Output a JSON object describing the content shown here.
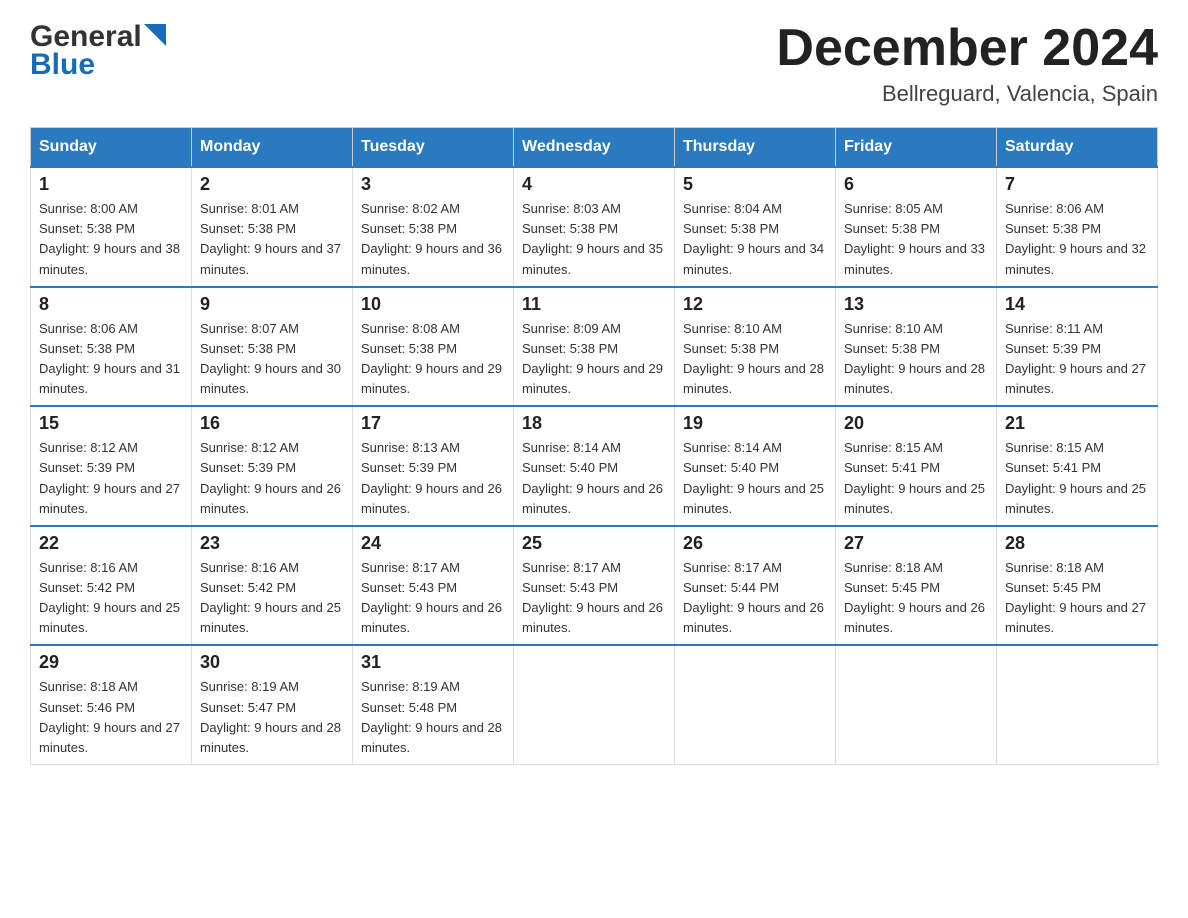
{
  "header": {
    "logo_general": "General",
    "logo_blue": "Blue",
    "month_title": "December 2024",
    "location": "Bellreguard, Valencia, Spain"
  },
  "weekdays": [
    "Sunday",
    "Monday",
    "Tuesday",
    "Wednesday",
    "Thursday",
    "Friday",
    "Saturday"
  ],
  "weeks": [
    [
      {
        "day": "1",
        "sunrise": "8:00 AM",
        "sunset": "5:38 PM",
        "daylight": "9 hours and 38 minutes."
      },
      {
        "day": "2",
        "sunrise": "8:01 AM",
        "sunset": "5:38 PM",
        "daylight": "9 hours and 37 minutes."
      },
      {
        "day": "3",
        "sunrise": "8:02 AM",
        "sunset": "5:38 PM",
        "daylight": "9 hours and 36 minutes."
      },
      {
        "day": "4",
        "sunrise": "8:03 AM",
        "sunset": "5:38 PM",
        "daylight": "9 hours and 35 minutes."
      },
      {
        "day": "5",
        "sunrise": "8:04 AM",
        "sunset": "5:38 PM",
        "daylight": "9 hours and 34 minutes."
      },
      {
        "day": "6",
        "sunrise": "8:05 AM",
        "sunset": "5:38 PM",
        "daylight": "9 hours and 33 minutes."
      },
      {
        "day": "7",
        "sunrise": "8:06 AM",
        "sunset": "5:38 PM",
        "daylight": "9 hours and 32 minutes."
      }
    ],
    [
      {
        "day": "8",
        "sunrise": "8:06 AM",
        "sunset": "5:38 PM",
        "daylight": "9 hours and 31 minutes."
      },
      {
        "day": "9",
        "sunrise": "8:07 AM",
        "sunset": "5:38 PM",
        "daylight": "9 hours and 30 minutes."
      },
      {
        "day": "10",
        "sunrise": "8:08 AM",
        "sunset": "5:38 PM",
        "daylight": "9 hours and 29 minutes."
      },
      {
        "day": "11",
        "sunrise": "8:09 AM",
        "sunset": "5:38 PM",
        "daylight": "9 hours and 29 minutes."
      },
      {
        "day": "12",
        "sunrise": "8:10 AM",
        "sunset": "5:38 PM",
        "daylight": "9 hours and 28 minutes."
      },
      {
        "day": "13",
        "sunrise": "8:10 AM",
        "sunset": "5:38 PM",
        "daylight": "9 hours and 28 minutes."
      },
      {
        "day": "14",
        "sunrise": "8:11 AM",
        "sunset": "5:39 PM",
        "daylight": "9 hours and 27 minutes."
      }
    ],
    [
      {
        "day": "15",
        "sunrise": "8:12 AM",
        "sunset": "5:39 PM",
        "daylight": "9 hours and 27 minutes."
      },
      {
        "day": "16",
        "sunrise": "8:12 AM",
        "sunset": "5:39 PM",
        "daylight": "9 hours and 26 minutes."
      },
      {
        "day": "17",
        "sunrise": "8:13 AM",
        "sunset": "5:39 PM",
        "daylight": "9 hours and 26 minutes."
      },
      {
        "day": "18",
        "sunrise": "8:14 AM",
        "sunset": "5:40 PM",
        "daylight": "9 hours and 26 minutes."
      },
      {
        "day": "19",
        "sunrise": "8:14 AM",
        "sunset": "5:40 PM",
        "daylight": "9 hours and 25 minutes."
      },
      {
        "day": "20",
        "sunrise": "8:15 AM",
        "sunset": "5:41 PM",
        "daylight": "9 hours and 25 minutes."
      },
      {
        "day": "21",
        "sunrise": "8:15 AM",
        "sunset": "5:41 PM",
        "daylight": "9 hours and 25 minutes."
      }
    ],
    [
      {
        "day": "22",
        "sunrise": "8:16 AM",
        "sunset": "5:42 PM",
        "daylight": "9 hours and 25 minutes."
      },
      {
        "day": "23",
        "sunrise": "8:16 AM",
        "sunset": "5:42 PM",
        "daylight": "9 hours and 25 minutes."
      },
      {
        "day": "24",
        "sunrise": "8:17 AM",
        "sunset": "5:43 PM",
        "daylight": "9 hours and 26 minutes."
      },
      {
        "day": "25",
        "sunrise": "8:17 AM",
        "sunset": "5:43 PM",
        "daylight": "9 hours and 26 minutes."
      },
      {
        "day": "26",
        "sunrise": "8:17 AM",
        "sunset": "5:44 PM",
        "daylight": "9 hours and 26 minutes."
      },
      {
        "day": "27",
        "sunrise": "8:18 AM",
        "sunset": "5:45 PM",
        "daylight": "9 hours and 26 minutes."
      },
      {
        "day": "28",
        "sunrise": "8:18 AM",
        "sunset": "5:45 PM",
        "daylight": "9 hours and 27 minutes."
      }
    ],
    [
      {
        "day": "29",
        "sunrise": "8:18 AM",
        "sunset": "5:46 PM",
        "daylight": "9 hours and 27 minutes."
      },
      {
        "day": "30",
        "sunrise": "8:19 AM",
        "sunset": "5:47 PM",
        "daylight": "9 hours and 28 minutes."
      },
      {
        "day": "31",
        "sunrise": "8:19 AM",
        "sunset": "5:48 PM",
        "daylight": "9 hours and 28 minutes."
      },
      null,
      null,
      null,
      null
    ]
  ]
}
